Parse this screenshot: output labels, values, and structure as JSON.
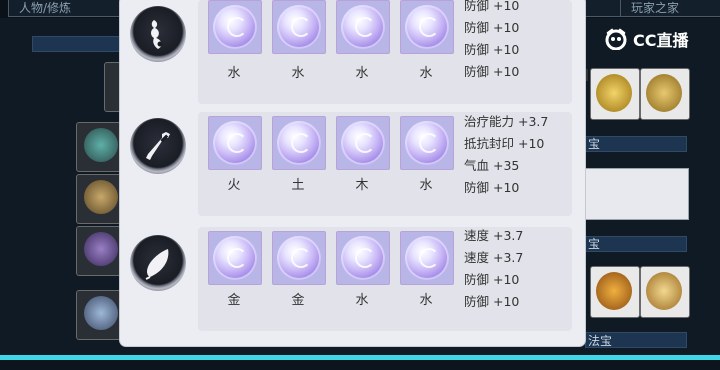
{
  "background": {
    "tabs": [
      "人物/修炼",
      "玩家之家"
    ],
    "labels": [
      "宝",
      "宝",
      "法宝"
    ]
  },
  "logo": {
    "text": "CC直播"
  },
  "groups": [
    {
      "icon": "ornament-icon",
      "gems": [
        "水",
        "水",
        "水",
        "水"
      ],
      "attrs": [
        "防御 +10",
        "防御 +10",
        "防御 +10",
        "防御 +10"
      ]
    },
    {
      "icon": "weapon-icon",
      "gems": [
        "火",
        "土",
        "木",
        "水"
      ],
      "attrs": [
        "治疗能力 +3.7",
        "抵抗封印 +10",
        "气血 +35",
        "防御 +10"
      ]
    },
    {
      "icon": "leaf-icon",
      "gems": [
        "金",
        "金",
        "水",
        "水"
      ],
      "attrs": [
        "速度 +3.7",
        "速度 +3.7",
        "防御 +10",
        "防御 +10"
      ]
    }
  ],
  "colors": {
    "accent_bar": "#3fd6e6",
    "popup_bg": "#ecedf2",
    "gem_slot": "#b8b6e6"
  }
}
